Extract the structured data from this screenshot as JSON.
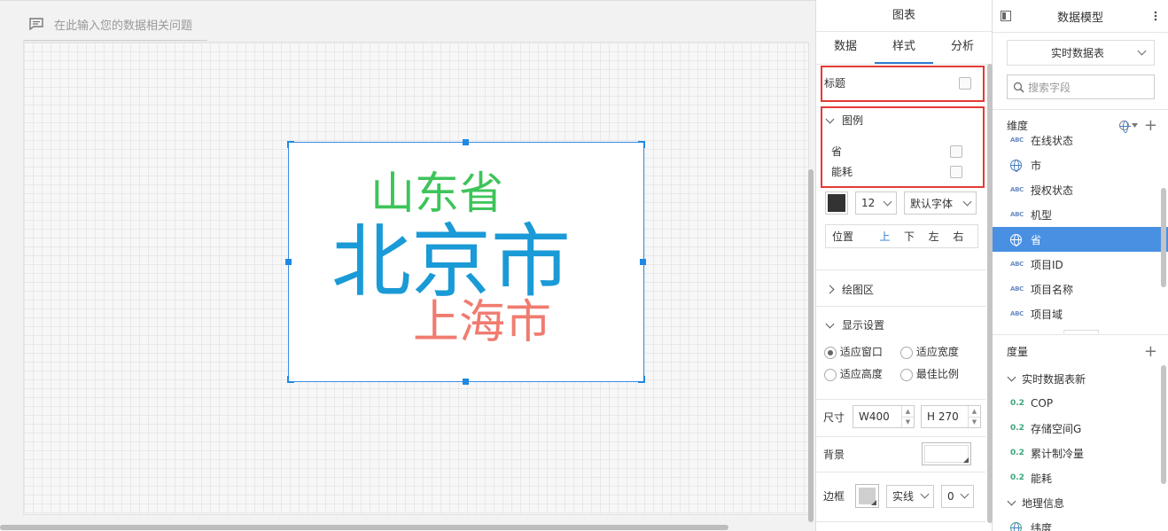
{
  "ask": {
    "placeholder": "在此输入您的数据相关问题"
  },
  "chart_data": {
    "type": "wordcloud",
    "words": [
      {
        "text": "北京市",
        "color": "#1a9ad6"
      },
      {
        "text": "山东省",
        "color": "#3ec45a"
      },
      {
        "text": "上海市",
        "color": "#f07b6f"
      }
    ]
  },
  "style_panel": {
    "title": "图表",
    "tabs": [
      "数据",
      "样式",
      "分析"
    ],
    "active_tab": 1,
    "title_label": "标题",
    "legend": {
      "label": "图例",
      "items": [
        "省",
        "能耗"
      ],
      "font_color": "#333333",
      "font_size": "12",
      "font_family": "默认字体",
      "position_label": "位置",
      "positions": [
        "上",
        "下",
        "左",
        "右"
      ],
      "active_position": 0
    },
    "plot_area_label": "绘图区",
    "display": {
      "label": "显示设置",
      "options": [
        "适应窗口",
        "适应宽度",
        "适应高度",
        "最佳比例"
      ],
      "selected": 0
    },
    "size": {
      "label": "尺寸",
      "w_label": "W",
      "w": "400",
      "h_label": "H",
      "h": "270"
    },
    "background_label": "背景",
    "border": {
      "label": "边框",
      "style": "实线",
      "width": "0"
    }
  },
  "model_panel": {
    "title": "数据模型",
    "table_select": "实时数据表",
    "search_placeholder": "搜索字段",
    "dimensions_label": "维度",
    "dimensions": [
      {
        "type": "abc",
        "label": "在线状态"
      },
      {
        "type": "geo",
        "label": "市"
      },
      {
        "type": "abc",
        "label": "授权状态"
      },
      {
        "type": "abc",
        "label": "机型"
      },
      {
        "type": "geo",
        "label": "省"
      },
      {
        "type": "abc",
        "label": "项目ID"
      },
      {
        "type": "abc",
        "label": "项目名称"
      },
      {
        "type": "abc",
        "label": "项目域"
      }
    ],
    "active_dimension": 4,
    "abc_tag": "ABC",
    "measures_label": "度量",
    "measure_group": "实时数据表新",
    "num_tag": "0.2",
    "measures": [
      "COP",
      "存储空间G",
      "累计制冷量",
      "能耗"
    ],
    "geo_group": "地理信息",
    "geo_fields": [
      "纬度"
    ]
  }
}
